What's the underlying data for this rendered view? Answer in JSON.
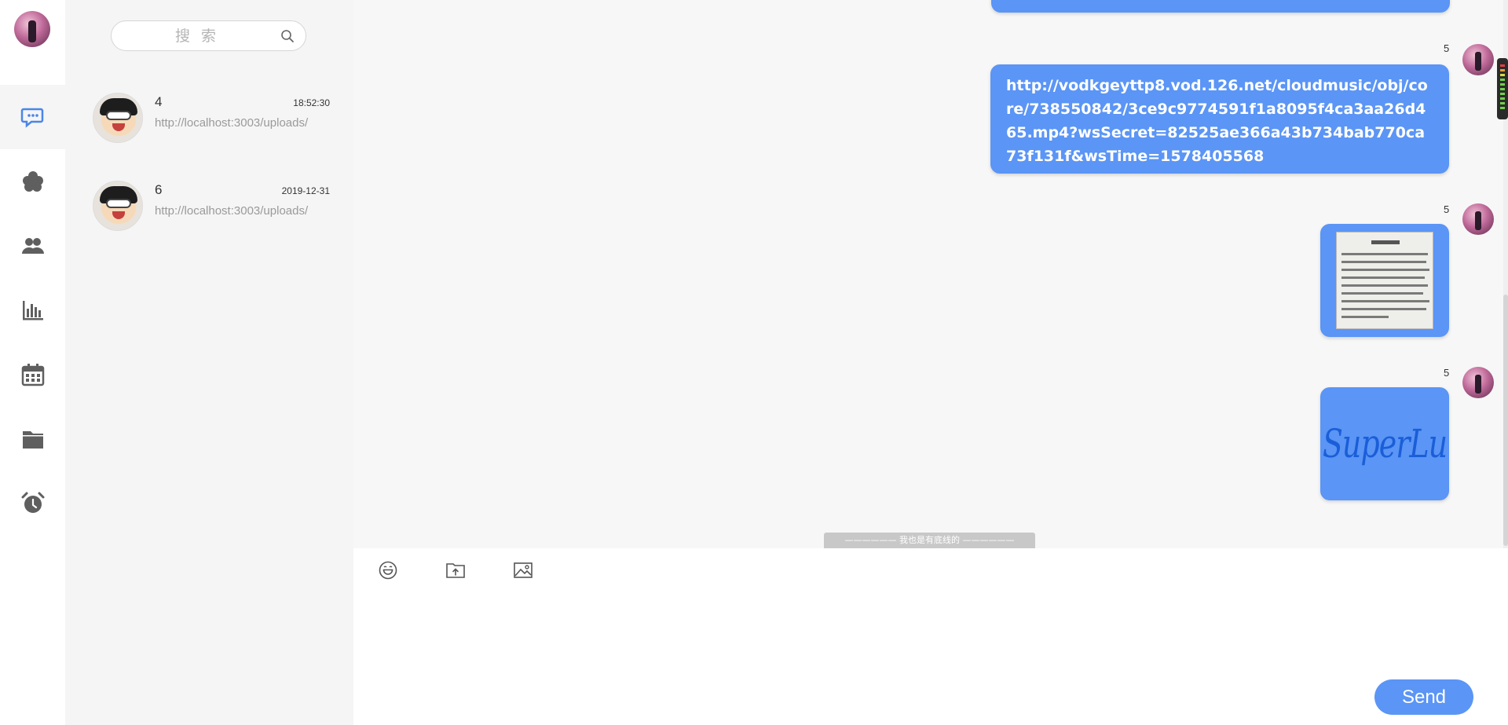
{
  "nav": {
    "items": [
      {
        "name": "messages",
        "icon": "chat-bubble-icon",
        "active": true
      },
      {
        "name": "moments",
        "icon": "flower-icon",
        "active": false
      },
      {
        "name": "contacts",
        "icon": "users-icon",
        "active": false
      },
      {
        "name": "stats",
        "icon": "bar-chart-icon",
        "active": false
      },
      {
        "name": "calendar",
        "icon": "calendar-icon",
        "active": false
      },
      {
        "name": "files",
        "icon": "folder-icon",
        "active": false
      },
      {
        "name": "alarm",
        "icon": "alarm-clock-icon",
        "active": false
      }
    ]
  },
  "search": {
    "placeholder": "搜 索",
    "icon": "search-icon"
  },
  "conversations": [
    {
      "name": "4",
      "time": "18:52:30",
      "preview": "http://localhost:3003/uploads/"
    },
    {
      "name": "6",
      "time": "2019-12-31",
      "preview": "http://localhost:3003/uploads/"
    }
  ],
  "messages": [
    {
      "sender": "5",
      "type": "text",
      "text": "http://vodkgeyttp8.vod.126.net/cloudmusic/obj/core/738550842/3ce9c9774591f1a8095f4ca3aa26d465.mp4?wsSecret=82525ae366a43b734bab770ca73f131f&wsTime=1578405568"
    },
    {
      "sender": "5",
      "type": "image",
      "image": "document-photo"
    },
    {
      "sender": "5",
      "type": "image",
      "image": "signature-superlu",
      "image_text": "SuperLu"
    }
  ],
  "bottom_tip": "——————  我也是有底线的  ——————",
  "input": {
    "tools": [
      "emoji-icon",
      "file-upload-icon",
      "image-icon"
    ],
    "send_label": "Send"
  },
  "colors": {
    "accent": "#5b95f5",
    "panel_bg": "#f5f5f5",
    "chat_bg": "#f7f7f7"
  }
}
